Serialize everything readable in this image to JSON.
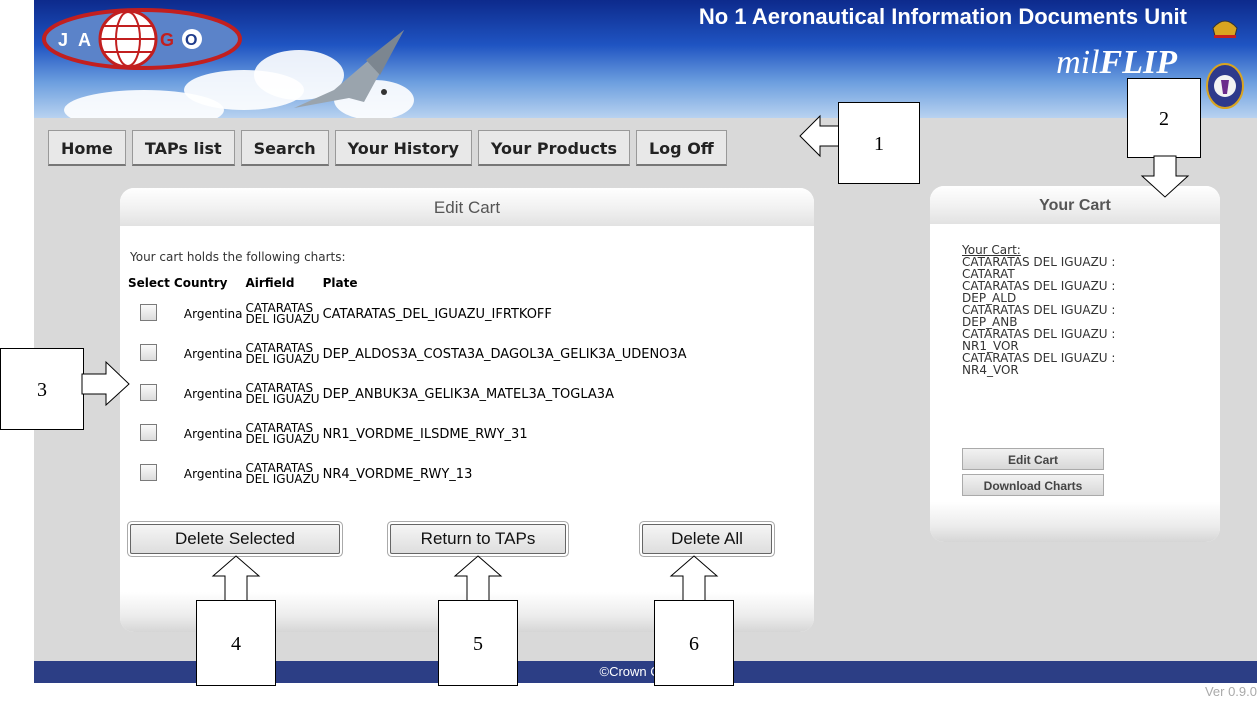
{
  "header": {
    "logo_letters": [
      "J",
      "A",
      "G",
      "O"
    ],
    "unit_title": "No 1 Aeronautical Information Documents Unit",
    "brand_prefix": "mil",
    "brand_suffix": "FLIP"
  },
  "nav": [
    {
      "label": "Home"
    },
    {
      "label": "TAPs list"
    },
    {
      "label": "Search"
    },
    {
      "label": "Your History"
    },
    {
      "label": "Your Products"
    },
    {
      "label": "Log Off"
    }
  ],
  "edit_cart": {
    "title": "Edit Cart",
    "intro": "Your cart holds the following charts:",
    "columns": [
      "Select",
      "Country",
      "Airfield",
      "Plate"
    ],
    "rows": [
      {
        "country": "Argentina",
        "airfield_line1": "CATARATAS",
        "airfield_line2": "DEL IGUAZU",
        "plate": "CATARATAS_DEL_IGUAZU_IFRTKOFF"
      },
      {
        "country": "Argentina",
        "airfield_line1": "CATARATAS",
        "airfield_line2": "DEL IGUAZU",
        "plate": "DEP_ALDOS3A_COSTA3A_DAGOL3A_GELIK3A_UDENO3A"
      },
      {
        "country": "Argentina",
        "airfield_line1": "CATARATAS",
        "airfield_line2": "DEL IGUAZU",
        "plate": "DEP_ANBUK3A_GELIK3A_MATEL3A_TOGLA3A"
      },
      {
        "country": "Argentina",
        "airfield_line1": "CATARATAS",
        "airfield_line2": "DEL IGUAZU",
        "plate": "NR1_VORDME_ILSDME_RWY_31"
      },
      {
        "country": "Argentina",
        "airfield_line1": "CATARATAS",
        "airfield_line2": "DEL IGUAZU",
        "plate": "NR4_VORDME_RWY_13"
      }
    ],
    "buttons": {
      "delete_selected": "Delete Selected",
      "return_to_taps": "Return to TAPs",
      "delete_all": "Delete All"
    }
  },
  "your_cart": {
    "title": "Your Cart",
    "label": "Your Cart:",
    "items": [
      "CATARATAS DEL IGUAZU :",
      "CATARAT",
      "CATARATAS DEL IGUAZU :",
      "DEP_ALD",
      "CATARATAS DEL IGUAZU :",
      "DEP_ANB",
      "CATARATAS DEL IGUAZU :",
      "NR1_VOR",
      "CATARATAS DEL IGUAZU :",
      "NR4_VOR"
    ],
    "edit_button": "Edit Cart",
    "download_button": "Download Charts"
  },
  "footer": {
    "copyright": "©Crown Copy        8",
    "version": "Ver 0.9.0"
  },
  "callouts": [
    "1",
    "2",
    "3",
    "4",
    "5",
    "6"
  ]
}
